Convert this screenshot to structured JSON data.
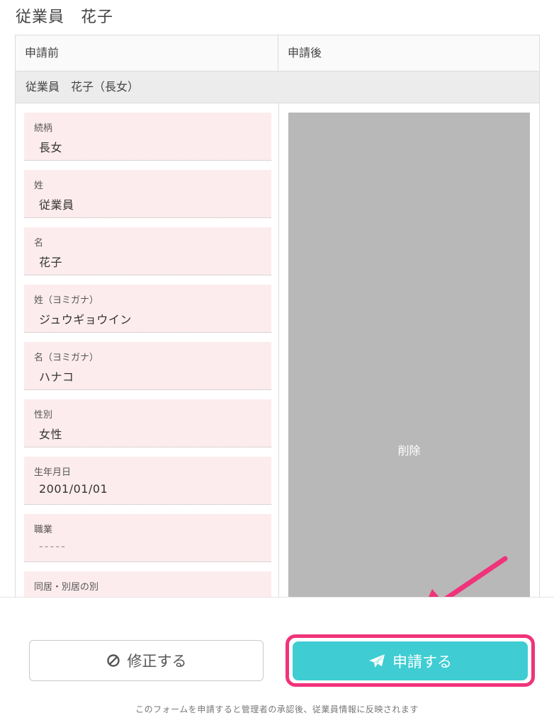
{
  "page_title": "従業員　花子",
  "table": {
    "header_before": "申請前",
    "header_after": "申請後",
    "group_title": "従業員　花子（長女）",
    "fields": [
      {
        "label": "続柄",
        "value": "長女"
      },
      {
        "label": "姓",
        "value": "従業員"
      },
      {
        "label": "名",
        "value": "花子"
      },
      {
        "label": "姓（ヨミガナ）",
        "value": "ジュウギョウイン"
      },
      {
        "label": "名（ヨミガナ）",
        "value": "ハナコ"
      },
      {
        "label": "性別",
        "value": "女性"
      },
      {
        "label": "生年月日",
        "value": "2001/01/01"
      },
      {
        "label": "職業",
        "value": "-----"
      },
      {
        "label": "同居・別居の別",
        "value": ""
      }
    ],
    "after_status": "削除"
  },
  "footer": {
    "edit_button": "修正する",
    "apply_button": "申請する",
    "note": "このフォームを申請すると管理者の承認後、従業員情報に反映されます"
  },
  "colors": {
    "accent": "#3fcdd3",
    "highlight": "#f0337a",
    "field_bg": "#fdecee",
    "deleted_bg": "#b8b8b8"
  },
  "icons": {
    "edit": "prohibit-icon",
    "apply": "paper-plane-icon",
    "annotation": "arrow-icon"
  }
}
